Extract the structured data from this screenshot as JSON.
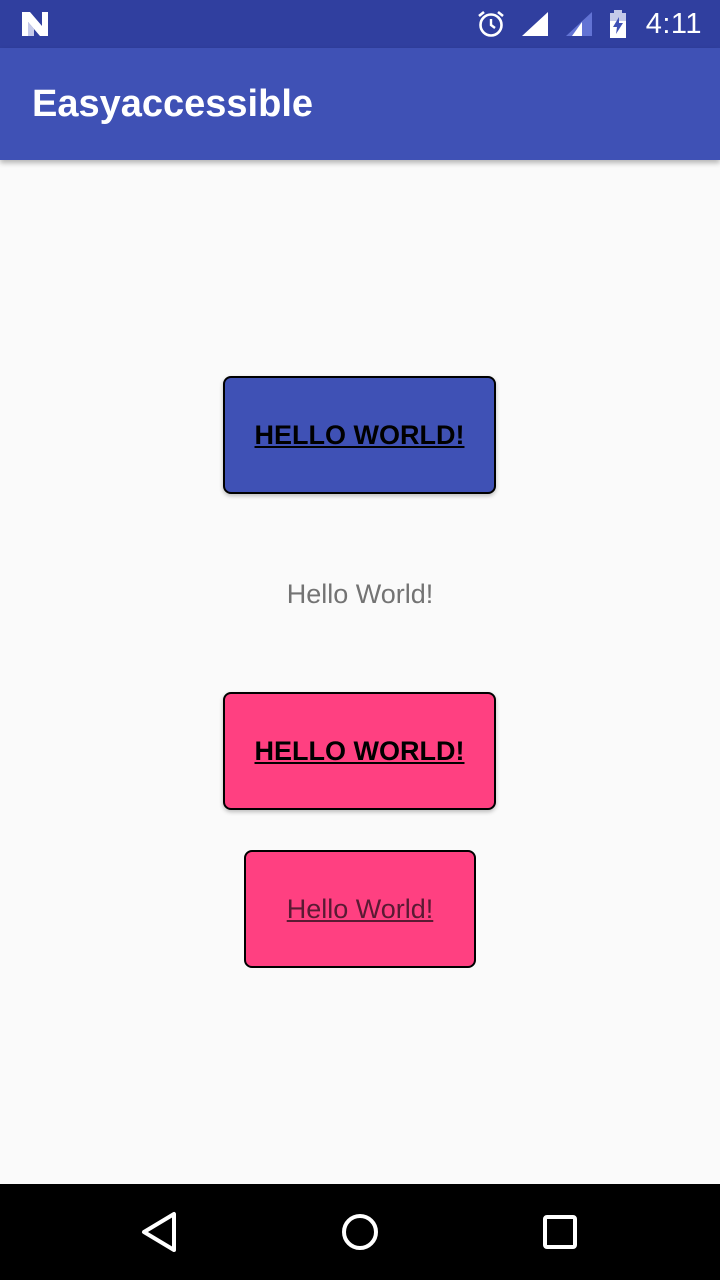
{
  "status_bar": {
    "time": "4:11",
    "icons": [
      "notification-n-icon",
      "alarm-icon",
      "wifi-signal-icon",
      "cell-signal-icon",
      "battery-charging-icon"
    ]
  },
  "app_bar": {
    "title": "Easyaccessible"
  },
  "main": {
    "button_primary_label": "HELLO WORLD!",
    "hello_text": "Hello World!",
    "button_accent_label": "HELLO WORLD!",
    "button_accent_secondary_label": "Hello World!"
  },
  "nav_bar": {
    "icons": [
      "back-icon",
      "home-icon",
      "recents-icon"
    ]
  },
  "colors": {
    "status_bar": "#303f9f",
    "primary": "#3f51b5",
    "accent": "#ff4081",
    "background": "#fafafa",
    "nav_bar": "#000000"
  }
}
